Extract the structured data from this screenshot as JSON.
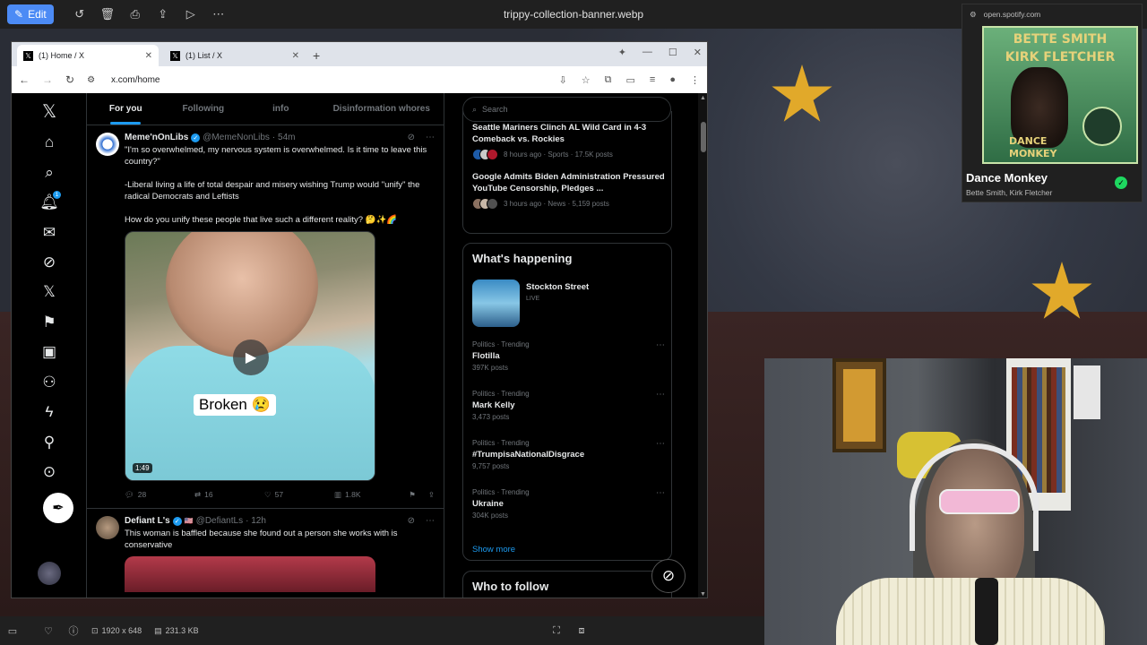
{
  "viewer": {
    "edit_label": "Edit",
    "title": "trippy-collection-banner.webp",
    "dimensions": "1920 x 648",
    "filesize": "231.3 KB"
  },
  "browser": {
    "tabs": [
      {
        "label": "(1) Home / X"
      },
      {
        "label": "(1) List / X"
      }
    ],
    "url": "x.com/home"
  },
  "x": {
    "timeline_tabs": [
      "For you",
      "Following",
      "info",
      "Disinformation whores"
    ],
    "tweets": [
      {
        "name": "Meme'nOnLibs",
        "handle": "@MemeNonLibs",
        "time": "· 54m",
        "text": "\"I'm so overwhelmed, my nervous system is overwhelmed. Is it time to leave this country?\"\n\n-Liberal living a life of total despair and misery wishing Trump would \"unify\" the radical Democrats and Leftists\n\nHow do you unify these people that live such a different reality? 🤔✨🌈",
        "video_caption": "Broken 😢",
        "duration": "1:49",
        "replies": "28",
        "reposts": "16",
        "likes": "57",
        "views": "1.8K"
      },
      {
        "name": "Defiant L's",
        "handle": "@DefiantLs",
        "time": "· 12h",
        "text": "This woman is baffled because she found out a person she works with is conservative"
      }
    ],
    "search_placeholder": "Search",
    "news": [
      {
        "title": "Seattle Mariners Clinch AL Wild Card in 4-3 Comeback vs. Rockies",
        "meta": "8 hours ago · Sports · 17.5K posts"
      },
      {
        "title": "Google Admits Biden Administration Pressured YouTube Censorship, Pledges ...",
        "meta": "3 hours ago · News · 5,159 posts"
      }
    ],
    "whats_happening": "What's happening",
    "live": {
      "name": "Stockton Street",
      "tag": "LIVE"
    },
    "trends": [
      {
        "category": "Politics · Trending",
        "name": "Flotilla",
        "count": "397K posts"
      },
      {
        "category": "Politics · Trending",
        "name": "Mark Kelly",
        "count": "3,473 posts"
      },
      {
        "category": "Politics · Trending",
        "name": "#TrumpisaNationalDisgrace",
        "count": "9,757 posts"
      },
      {
        "category": "Politics · Trending",
        "name": "Ukraine",
        "count": "304K posts"
      }
    ],
    "show_more": "Show more",
    "who_to_follow": "Who to follow"
  },
  "spotify": {
    "url": "open.spotify.com",
    "art_title": "BETTE SMITH\nKIRK FLETCHER",
    "art_subtitle": "DANCE\nMONKEY",
    "track": "Dance Monkey",
    "artists": "Bette Smith, Kirk Fletcher"
  }
}
